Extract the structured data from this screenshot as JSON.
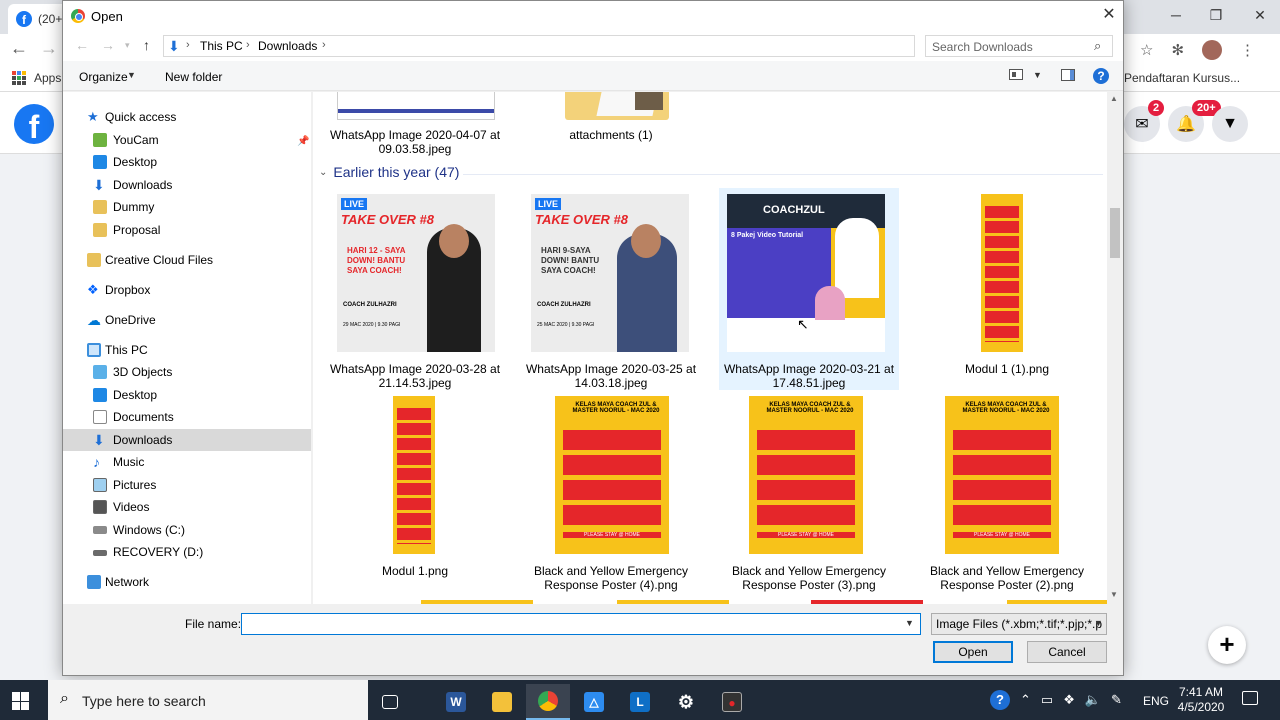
{
  "browser": {
    "tab_title": "(20+",
    "bookmarks": {
      "apps": "Apps",
      "item": "Pendaftaran Kursus..."
    },
    "fb": {
      "logo": "f",
      "badge_messenger": "2",
      "badge_notifications": "20+"
    }
  },
  "dialog": {
    "title": "Open",
    "breadcrumb": [
      "This PC",
      "Downloads"
    ],
    "search_placeholder": "Search Downloads",
    "toolbar": {
      "organize": "Organize",
      "new_folder": "New folder"
    },
    "nav": {
      "quick_access": "Quick access",
      "quick_items": [
        "YouCam",
        "Desktop",
        "Downloads",
        "Dummy",
        "Proposal"
      ],
      "creative_cloud": "Creative Cloud Files",
      "dropbox": "Dropbox",
      "onedrive": "OneDrive",
      "this_pc": "This PC",
      "pc_items": [
        "3D Objects",
        "Desktop",
        "Documents",
        "Downloads",
        "Music",
        "Pictures",
        "Videos",
        "Windows (C:)",
        "RECOVERY (D:)"
      ],
      "network": "Network"
    },
    "group_header": "Earlier this year (47)",
    "top_files": [
      {
        "name": "WhatsApp Image 2020-04-07 at 09.03.58.jpeg"
      },
      {
        "name": "attachments (1)"
      }
    ],
    "files_row1": [
      {
        "name": "WhatsApp Image 2020-03-28 at 21.14.53.jpeg",
        "thumb_text": [
          "LIVE",
          "TAKE OVER #8",
          "HARI 12 - SAYA DOWN! BANTU SAYA COACH!",
          "COACH ZULHAZRI",
          "29 MAC 2020 | 9.30 PAGI"
        ]
      },
      {
        "name": "WhatsApp Image 2020-03-25 at 14.03.18.jpeg",
        "thumb_text": [
          "LIVE",
          "TAKE OVER #8",
          "HARI 9-SAYA DOWN! BANTU SAYA COACH!",
          "COACH ZULHAZRI",
          "25 MAC 2020 | 9.30 PAGI"
        ]
      },
      {
        "name": "WhatsApp Image 2020-03-21 at 17.48.51.jpeg",
        "thumb_text": [
          "COACHZUL",
          "8 Pakej Video Tutorial"
        ]
      },
      {
        "name": "Modul 1 (1).png"
      }
    ],
    "files_row2": [
      {
        "name": "Modul 1.png"
      },
      {
        "name": "Black and Yellow Emergency Response Poster (4).png",
        "thumb_text": [
          "KELAS MAYA COACH ZUL & MASTER NOORUL - MAC 2020",
          "PLEASE STAY @ HOME"
        ]
      },
      {
        "name": "Black and Yellow Emergency Response Poster (3).png",
        "thumb_text": [
          "KELAS MAYA COACH ZUL & MASTER NOORUL - MAC 2020",
          "PLEASE STAY @ HOME"
        ]
      },
      {
        "name": "Black and Yellow Emergency Response Poster (2).png",
        "thumb_text": [
          "KELAS MAYA COACH ZUL & MASTER NOORUL - MAC 2020",
          "PLEASE STAY @ HOME"
        ]
      }
    ],
    "file_name_label": "File name:",
    "file_name_value": "",
    "file_type": "Image Files (*.xbm;*.tif;*.pjp;*.p",
    "open_button": "Open",
    "cancel_button": "Cancel"
  },
  "taskbar": {
    "search_text": "Type here to search",
    "language": "ENG",
    "time": "7:41 AM",
    "date": "4/5/2020"
  },
  "colors": {
    "accent": "#0078d7",
    "group_header": "#1e3287",
    "fb_blue": "#1877f2",
    "poster_red": "#e5262a",
    "poster_yellow": "#f7c21a"
  }
}
